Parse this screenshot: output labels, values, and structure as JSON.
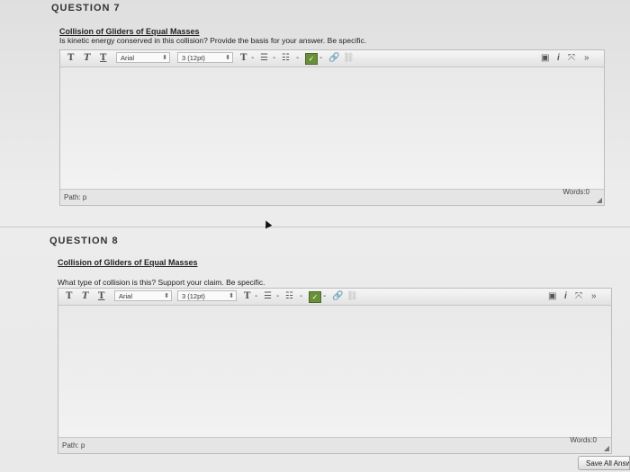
{
  "questions": [
    {
      "heading": "QUESTION 7",
      "title": "Collision of Gliders of Equal Masses",
      "prompt": "Is kinetic energy conserved in this collision? Provide the basis for your answer. Be specific.",
      "font_family": "Arial",
      "font_size": "3 (12pt)",
      "path": "Path: p",
      "words": "Words:0"
    },
    {
      "heading": "QUESTION 8",
      "title": "Collision of Gliders of Equal Masses",
      "prompt": "What type of collision is this? Support your claim. Be specific.",
      "font_family": "Arial",
      "font_size": "3 (12pt)",
      "path": "Path: p",
      "words": "Words:0"
    }
  ],
  "toolbar": {
    "bold": "T",
    "italic": "T",
    "underline": "T",
    "text_color": "T",
    "separator": "-",
    "bullets_glyph": "☰",
    "numbering_glyph": "☷"
  },
  "save_all_label": "Save All Answers",
  "colors": {
    "spellcheck": "#6a8f3a"
  }
}
